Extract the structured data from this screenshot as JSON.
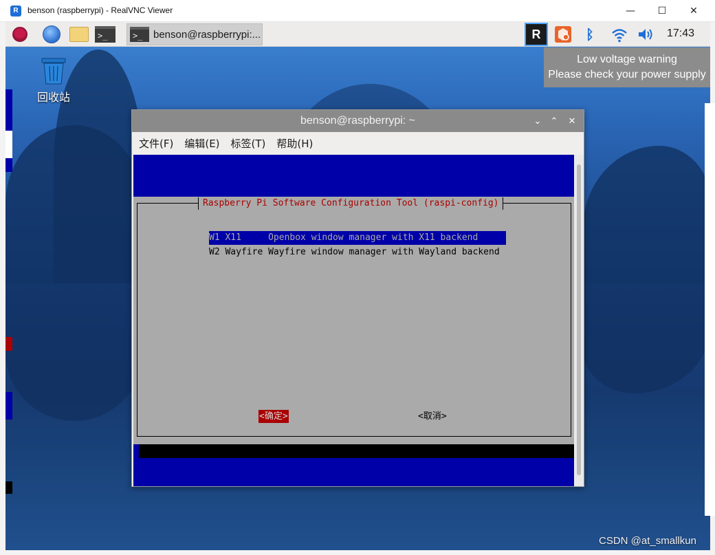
{
  "vnc_window": {
    "title": "benson (raspberrypi) - RealVNC Viewer",
    "logo_text": "R",
    "controls": {
      "minimize_glyph": "—",
      "maximize_glyph": "☐",
      "close_glyph": "✕"
    }
  },
  "taskbar": {
    "launchers": [
      "raspberry-pi-menu-icon",
      "web-browser-icon",
      "file-manager-icon",
      "terminal-icon"
    ],
    "terminal_glyph": ">_",
    "active_task_label": "benson@raspberrypi:...",
    "tray": {
      "vnc_text": "R",
      "icons": [
        "realvnc-server-icon",
        "updater-icon",
        "bluetooth-icon",
        "wifi-icon",
        "volume-icon"
      ],
      "bluetooth_glyph": "ᛒ",
      "clock": "17:43"
    }
  },
  "notification": {
    "line1": "Low voltage warning",
    "line2": "Please check your power supply"
  },
  "desktop": {
    "trash_label": "回收站"
  },
  "terminal_window": {
    "title": "benson@raspberrypi: ~",
    "controls": {
      "minimize_glyph": "⌄",
      "maximize_glyph": "⌃",
      "close_glyph": "✕"
    },
    "menu": [
      "文件(F)",
      "编辑(E)",
      "标签(T)",
      "帮助(H)"
    ]
  },
  "raspi_config": {
    "title": "Raspberry Pi Software Configuration Tool (raspi-config)",
    "options": [
      {
        "text": "W1 X11     Openbox window manager with X11 backend",
        "selected": true
      },
      {
        "text": "W2 Wayfire Wayfire window manager with Wayland backend",
        "selected": false
      }
    ],
    "ok_button": "<确定>",
    "cancel_button": "<取消>"
  },
  "watermark": "CSDN @at_smallkun",
  "colors": {
    "dialog_bg": "#aaaaaa",
    "terminal_bg": "#0000a8",
    "title_red": "#aa0000",
    "selection_bg": "#0000a8"
  }
}
